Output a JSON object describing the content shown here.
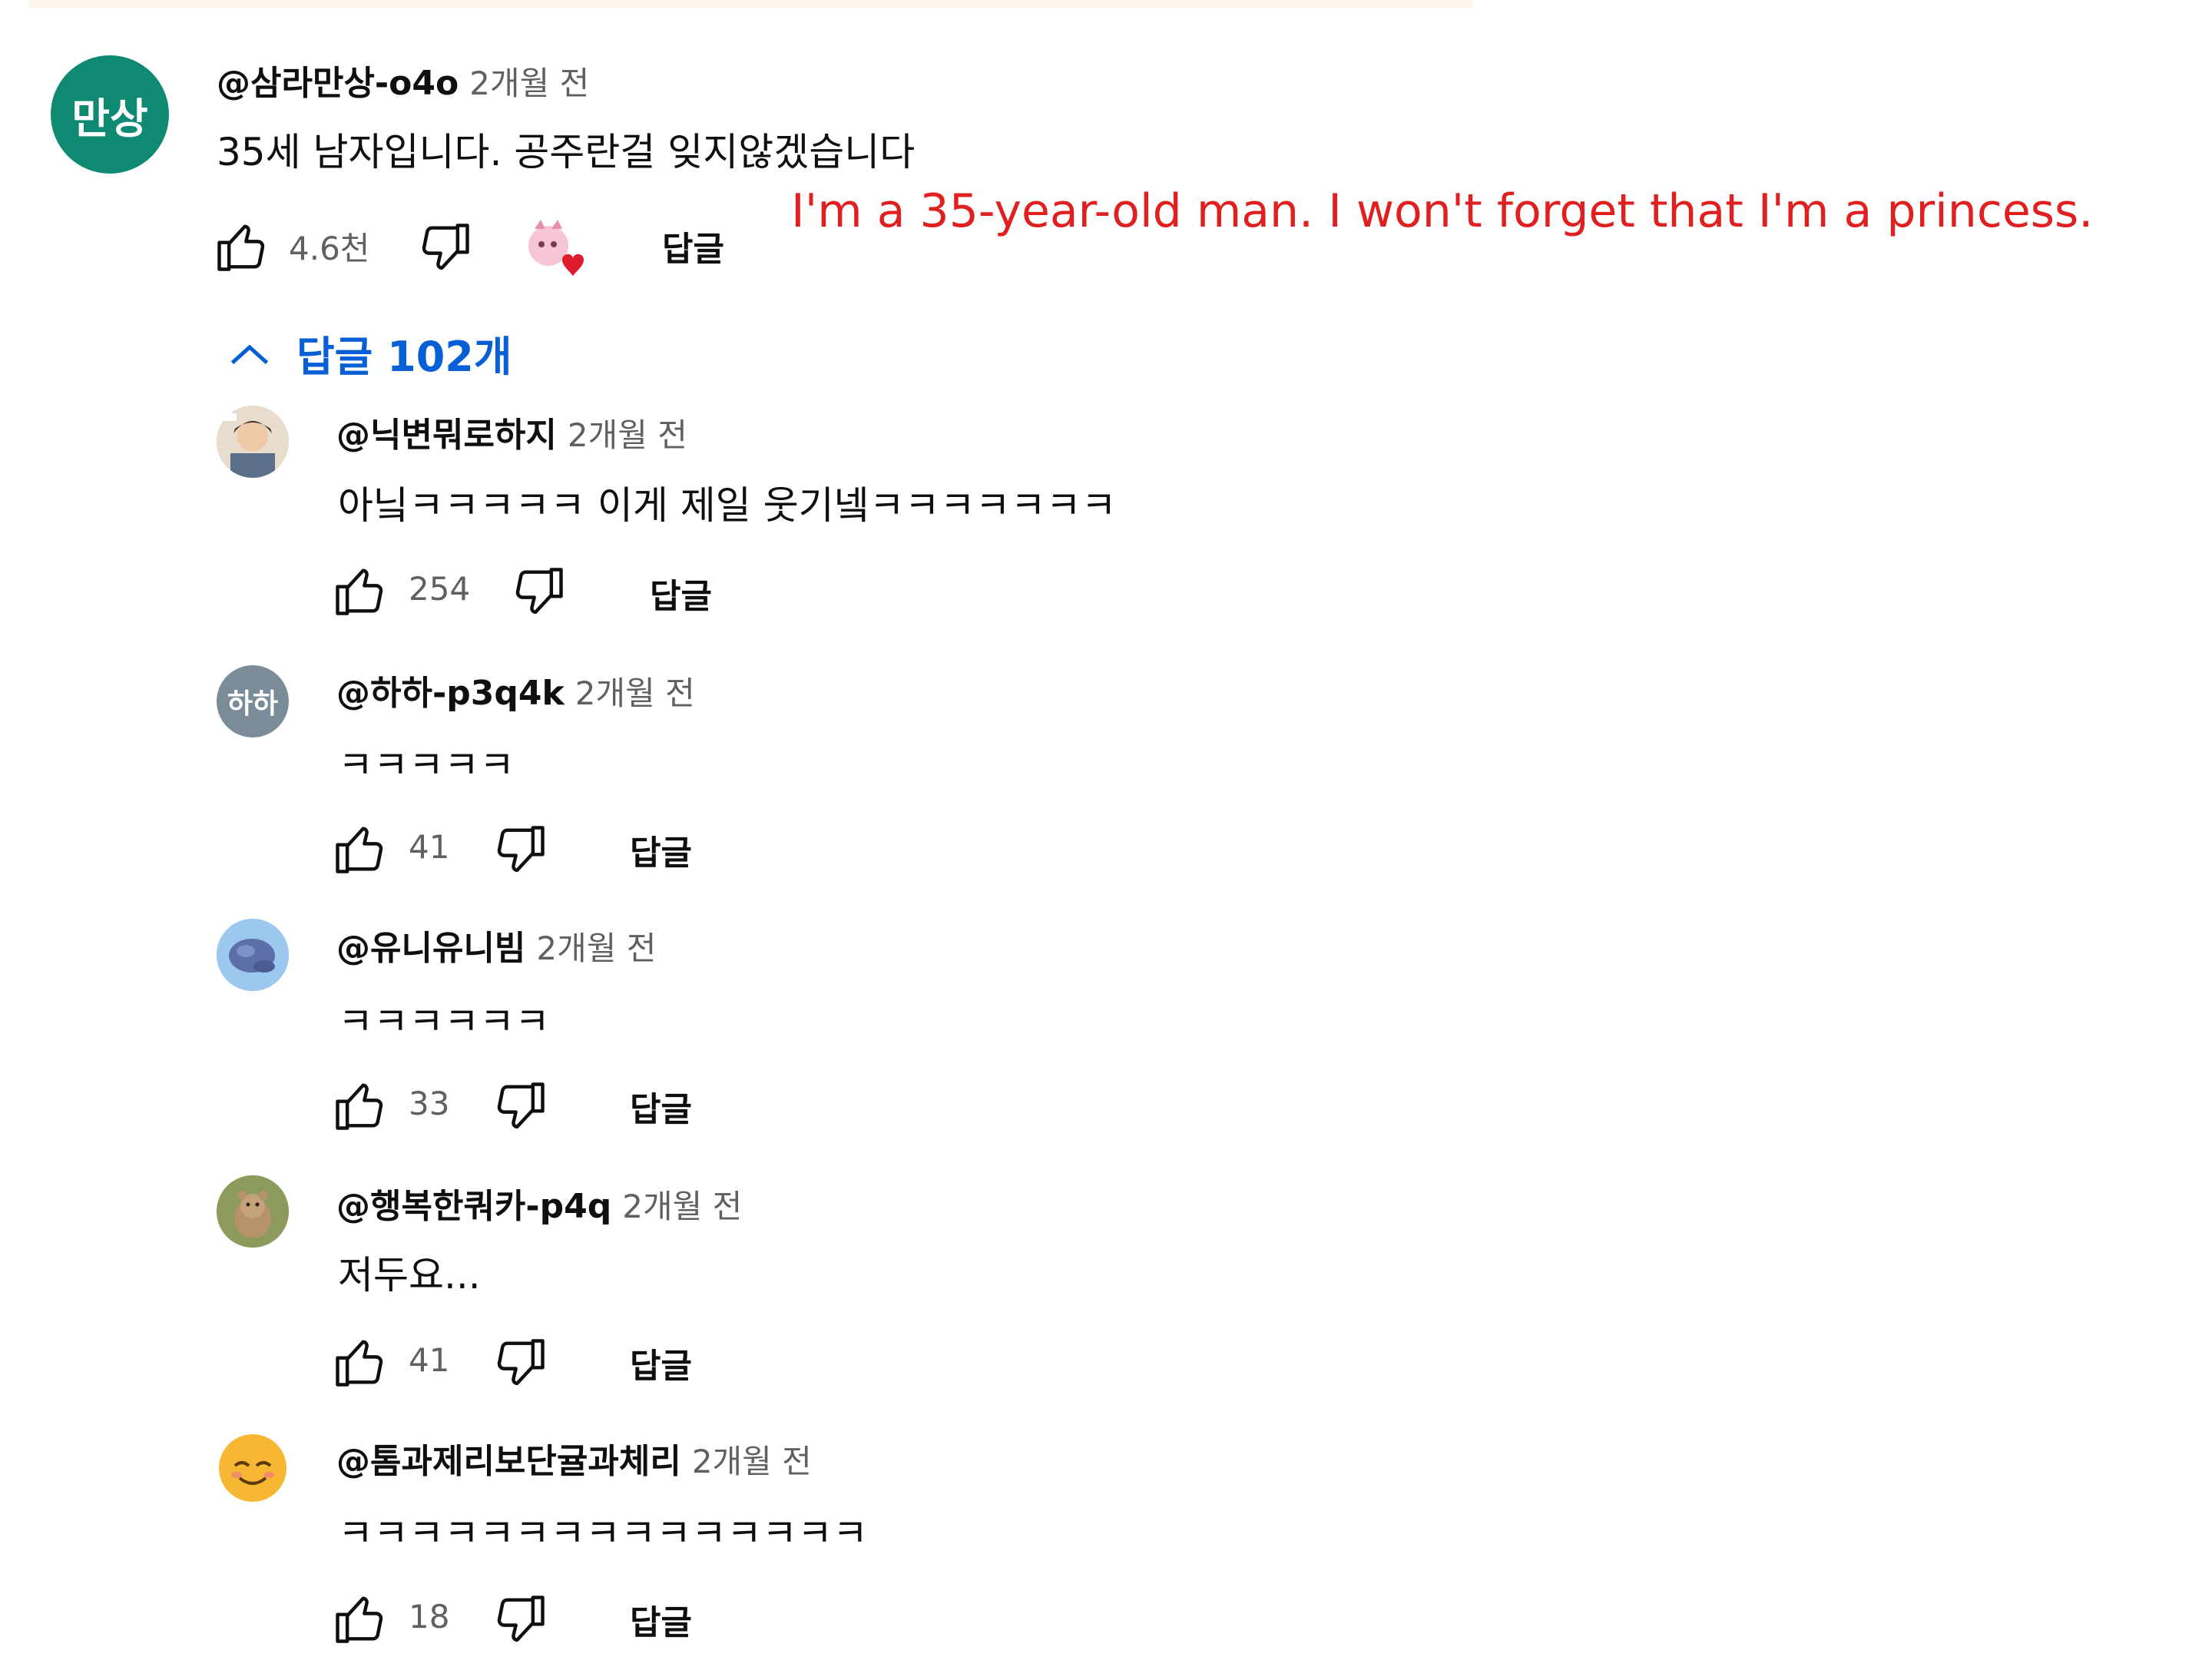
{
  "main_comment": {
    "avatar_text": "만상",
    "handle": "@삼라만상-o4o",
    "time": "2개월 전",
    "text": "35세 남자입니다. 공주란걸 잊지않겠습니다",
    "likes": "4.6천",
    "reply_label": "답글",
    "annotation": "I'm a 35-year-old man. I won't forget that I'm a princess."
  },
  "replies_toggle": {
    "label": "답글 102개"
  },
  "replies": [
    {
      "handle": "@닉변뭐로하지",
      "time": "2개월 전",
      "text": "아닠ㅋㅋㅋㅋㅋ 이게 제일 웃기넼ㅋㅋㅋㅋㅋㅋㅋ",
      "likes": "254",
      "reply_label": "답글"
    },
    {
      "handle": "@하하-p3q4k",
      "avatar_text": "하하",
      "time": "2개월 전",
      "text": "ㅋㅋㅋㅋㅋ",
      "likes": "41",
      "reply_label": "답글"
    },
    {
      "handle": "@유니유니빔",
      "time": "2개월 전",
      "text": "ㅋㅋㅋㅋㅋㅋ",
      "likes": "33",
      "reply_label": "답글"
    },
    {
      "handle": "@행복한쿼카-p4q",
      "time": "2개월 전",
      "text": "저두요...",
      "likes": "41",
      "reply_label": "답글"
    },
    {
      "handle": "@톰과제리보단귤과체리",
      "time": "2개월 전",
      "text": "ㅋㅋㅋㅋㅋㅋㅋㅋㅋㅋㅋㅋㅋㅋㅋ",
      "likes": "18",
      "reply_label": "답글"
    }
  ],
  "colors": {
    "accent_blue": "#065fd4",
    "annotation_red": "#e02020",
    "avatar_main": "#0f8a72",
    "avatar_haha": "#7b8c99"
  }
}
